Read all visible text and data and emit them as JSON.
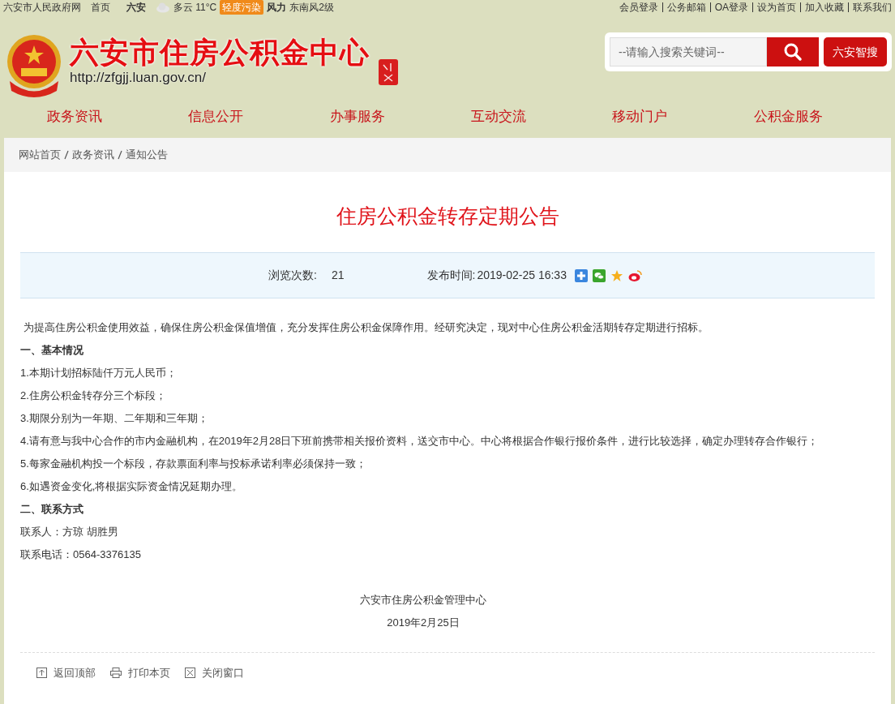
{
  "top_bar": {
    "left_links": [
      "六安市人民政府网",
      "首页"
    ],
    "weather": {
      "city": "六安",
      "condition": "多云 11°C",
      "air_quality": "轻度污染",
      "wind_label": "风力",
      "wind": "东南风2级"
    },
    "right_links": [
      "会员登录",
      "公务邮箱",
      "OA登录",
      "设为首页",
      "加入收藏",
      "联系我们"
    ]
  },
  "header": {
    "site_title": "六安市住房公积金中心",
    "site_url": "http://zfgjj.luan.gov.cn/",
    "search": {
      "placeholder": "--请输入搜索关键词--"
    },
    "smart_search_button": "六安智搜"
  },
  "nav": [
    "政务资讯",
    "信息公开",
    "办事服务",
    "互动交流",
    "移动门户",
    "公积金服务"
  ],
  "breadcrumb": [
    "网站首页",
    "政务资讯",
    "通知公告"
  ],
  "article": {
    "title": "住房公积金转存定期公告",
    "views_label": "浏览次数:",
    "views": "21",
    "published_label": "发布时间:",
    "published": "2019-02-25 16:33",
    "paragraphs": [
      {
        "kind": "text",
        "text": " 为提高住房公积金使用效益，确保住房公积金保值增值，充分发挥住房公积金保障作用。经研究决定，现对中心住房公积金活期转存定期进行招标。"
      },
      {
        "kind": "heading",
        "text": "一、基本情况"
      },
      {
        "kind": "text",
        "text": "1.本期计划招标陆仟万元人民币；"
      },
      {
        "kind": "text",
        "text": "2.住房公积金转存分三个标段；"
      },
      {
        "kind": "text",
        "text": "3.期限分别为一年期、二年期和三年期；"
      },
      {
        "kind": "text",
        "text": "4.请有意与我中心合作的市内金融机构，在2019年2月28日下班前携带相关报价资料，送交市中心。中心将根据合作银行报价条件，进行比较选择，确定办理转存合作银行；"
      },
      {
        "kind": "text",
        "text": "5.每家金融机构投一个标段，存款票面利率与投标承诺利率必须保持一致；"
      },
      {
        "kind": "text",
        "text": "6.如遇资金变化,将根据实际资金情况延期办理。"
      },
      {
        "kind": "heading",
        "text": "二、联系方式"
      },
      {
        "kind": "text",
        "text": "联系人：方琼 胡胜男"
      },
      {
        "kind": "text",
        "text": "联系电话：0564-3376135"
      }
    ],
    "signature": [
      "六安市住房公积金管理中心",
      "2019年2月25日"
    ]
  },
  "footer_actions": [
    "返回顶部",
    "打印本页",
    "关闭窗口"
  ]
}
